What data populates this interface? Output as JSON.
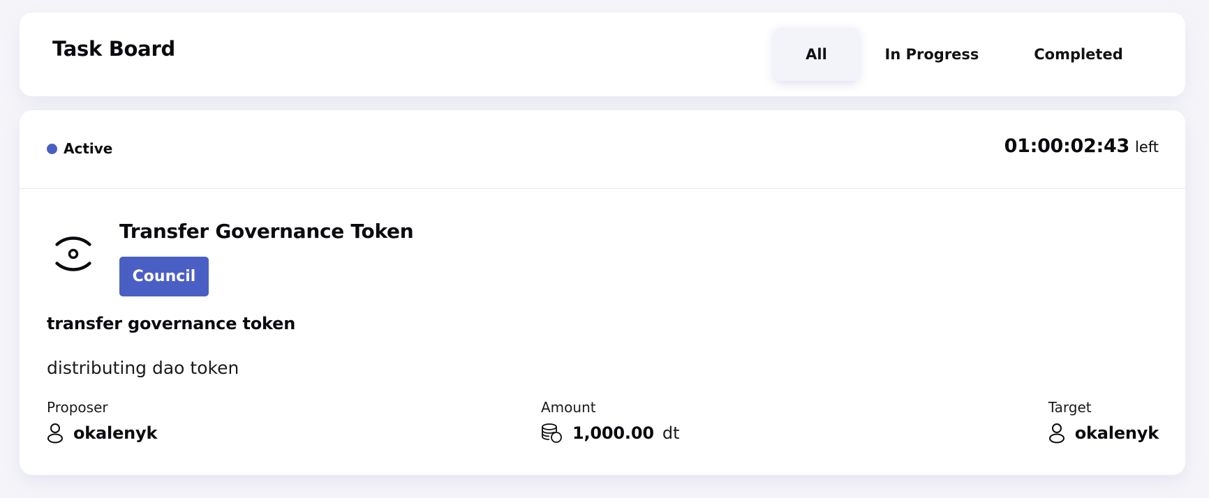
{
  "header": {
    "title": "Task Board",
    "tabs": [
      {
        "label": "All",
        "active": true
      },
      {
        "label": "In Progress",
        "active": false
      },
      {
        "label": "Completed",
        "active": false
      }
    ]
  },
  "proposal": {
    "status": "Active",
    "status_color": "#4a5fc4",
    "time_remaining": "01:00:02:43",
    "time_suffix": "left",
    "type_icon": "circle-target-icon",
    "title": "Transfer Governance Token",
    "group": "Council",
    "group_color": "#4a5fc4",
    "name": "transfer governance token",
    "description": "distributing dao token",
    "proposer": {
      "label": "Proposer",
      "value": "okalenyk",
      "icon": "user-icon"
    },
    "amount": {
      "label": "Amount",
      "value": "1,000.00",
      "unit": "dt",
      "icon": "coins-icon"
    },
    "target": {
      "label": "Target",
      "value": "okalenyk",
      "icon": "user-icon"
    }
  }
}
